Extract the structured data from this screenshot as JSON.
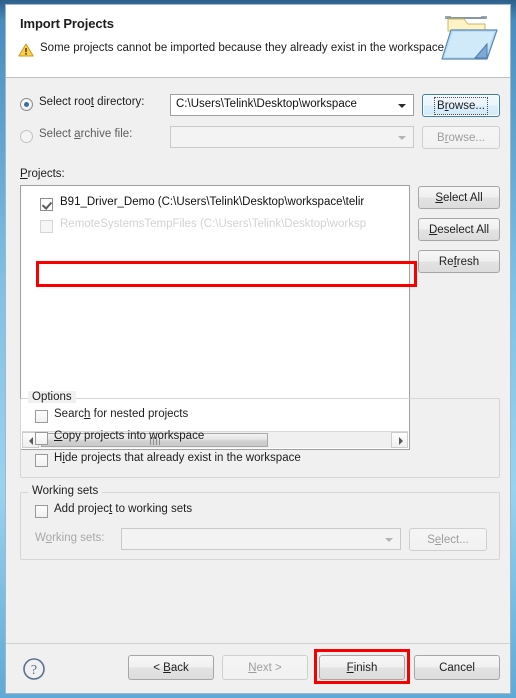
{
  "window": {
    "title": "Import Projects"
  },
  "header": {
    "title": "Import Projects",
    "warning_message": "Some projects cannot be imported because they already exist in the workspace",
    "warning_icon": "warning-triangle-icon",
    "banner_icon": "folder-import-icon"
  },
  "source": {
    "root_directory": {
      "label_pre": "Select roo",
      "label_mnemonic": "t",
      "label_post": " directory:",
      "selected": true,
      "value": "C:\\Users\\Telink\\Desktop\\workspace",
      "browse_pre": "B",
      "browse_mnemonic": "r",
      "browse_post": "owse...",
      "browse_enabled": true
    },
    "archive_file": {
      "label_pre": "Select ",
      "label_mnemonic": "a",
      "label_post": "rchive file:",
      "selected": false,
      "value": "",
      "browse_pre": "B",
      "browse_mnemonic": "r",
      "browse_post": "owse...",
      "browse_enabled": false
    }
  },
  "projects": {
    "label_pre": "",
    "label_mnemonic": "P",
    "label_post": "rojects:",
    "items": [
      {
        "text": "B91_Driver_Demo (C:\\Users\\Telink\\Desktop\\workspace\\telir",
        "checked": true,
        "enabled": true
      },
      {
        "text": "RemoteSystemsTempFiles (C:\\Users\\Telink\\Desktop\\worksp",
        "checked": false,
        "enabled": false
      }
    ],
    "buttons": [
      {
        "pre": "",
        "mnemonic": "S",
        "post": "elect All",
        "enabled": true,
        "name": "select-all-button"
      },
      {
        "pre": "",
        "mnemonic": "D",
        "post": "eselect All",
        "enabled": true,
        "name": "deselect-all-button"
      },
      {
        "pre": "Re",
        "mnemonic": "f",
        "post": "resh",
        "enabled": true,
        "name": "refresh-button"
      }
    ],
    "scrollbar": {
      "left_arrow": "scroll-left-icon",
      "right_arrow": "scroll-right-icon"
    }
  },
  "options": {
    "title": "Options",
    "checkboxes": [
      {
        "pre": "Searc",
        "mnemonic": "h",
        "post": " for nested projects",
        "checked": false,
        "name": "search-nested-projects-checkbox"
      },
      {
        "pre": "",
        "mnemonic": "C",
        "post": "opy projects into workspace",
        "checked": false,
        "name": "copy-projects-checkbox"
      },
      {
        "pre": "H",
        "mnemonic": "i",
        "post": "de projects that already exist in the workspace",
        "checked": false,
        "name": "hide-existing-projects-checkbox"
      }
    ]
  },
  "working_sets": {
    "title": "Working sets",
    "add_checkbox": {
      "pre": "Add projec",
      "mnemonic": "t",
      "post": " to working sets",
      "checked": false
    },
    "combo_label_pre": "W",
    "combo_label_mnemonic": "o",
    "combo_label_post": "rking sets:",
    "combo_value": "",
    "select_button": {
      "pre": "S",
      "mnemonic": "e",
      "post": "lect...",
      "enabled": false
    }
  },
  "footer": {
    "help_icon": "help-question-icon",
    "buttons": [
      {
        "pre": "< ",
        "mnemonic": "B",
        "post": "ack",
        "enabled": true,
        "name": "back-button"
      },
      {
        "pre": "",
        "mnemonic": "N",
        "post": "ext >",
        "enabled": false,
        "name": "next-button"
      },
      {
        "pre": "",
        "mnemonic": "F",
        "post": "inish",
        "enabled": true,
        "name": "finish-button"
      },
      {
        "pre": "Cancel",
        "mnemonic": "",
        "post": "",
        "enabled": true,
        "name": "cancel-button"
      }
    ]
  },
  "annotations": {
    "highlight_color": "#f90000",
    "highlighted_elements": [
      "selected-project-row",
      "finish-button"
    ]
  }
}
